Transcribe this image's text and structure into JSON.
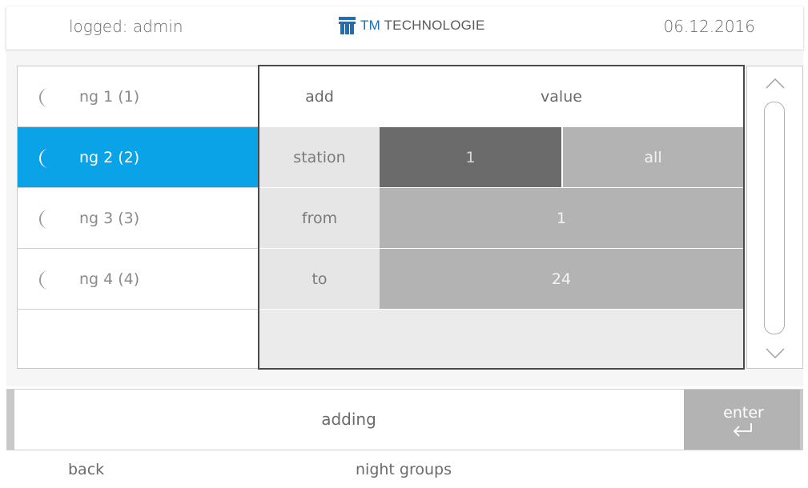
{
  "header": {
    "logged_user": "logged: admin",
    "brand": {
      "tm": "TM",
      "name": "TECHNOLOGIE",
      "color": "#1e6fb3"
    },
    "date": "06.12.2016"
  },
  "groups": {
    "icon": "moon-icon",
    "selected_color": "#0ba3e7",
    "items": [
      {
        "label": "ng 1 (1)",
        "selected": false
      },
      {
        "label": "ng 2 (2)",
        "selected": true
      },
      {
        "label": "ng 3 (3)",
        "selected": false
      },
      {
        "label": "ng 4 (4)",
        "selected": false
      }
    ]
  },
  "table": {
    "headers": {
      "add": "add",
      "value": "value"
    },
    "rows": {
      "station": {
        "key": "station",
        "options": [
          "1",
          "all"
        ],
        "selected": "1"
      },
      "from": {
        "key": "from",
        "value": "1"
      },
      "to": {
        "key": "to",
        "value": "24"
      }
    }
  },
  "scrollbar": {
    "up_icon": "chevron-up-icon",
    "down_icon": "chevron-down-icon"
  },
  "action": {
    "mode": "adding",
    "enter_label": "enter",
    "enter_icon": "return-arrow-icon"
  },
  "footer": {
    "back_label": "back",
    "screen_title": "night groups"
  }
}
